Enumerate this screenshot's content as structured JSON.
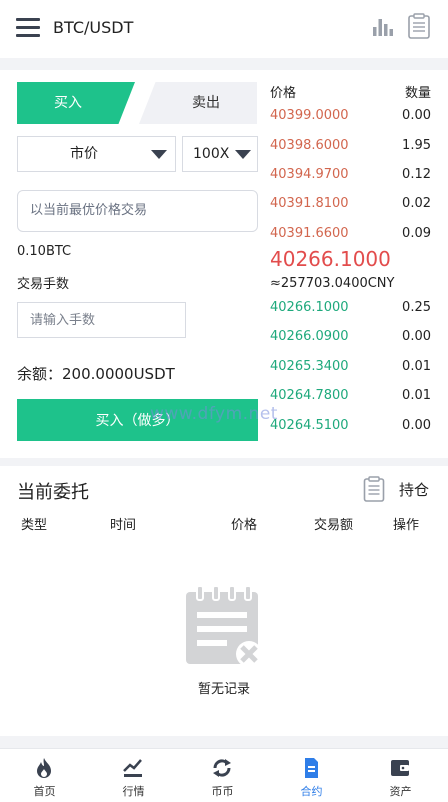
{
  "header": {
    "pair": "BTC/USDT",
    "menu_icon": "hamburger-menu-icon",
    "chart_icon": "bar-chart-icon",
    "orders_icon": "clipboard-icon"
  },
  "trade": {
    "tab_buy": "买入",
    "tab_sell": "卖出",
    "order_type": "市价",
    "leverage": "100X",
    "best_price_text": "以当前最优价格交易",
    "amount_text": "0.10BTC",
    "hands_label": "交易手数",
    "hands_placeholder": "请输入手数",
    "balance": "余额：200.0000USDT",
    "buy_button": "买入（做多）"
  },
  "orderbook": {
    "price_header": "价格",
    "qty_header": "数量",
    "asks": [
      {
        "price": "40399.0000",
        "qty": "0.00"
      },
      {
        "price": "40398.6000",
        "qty": "1.95"
      },
      {
        "price": "40394.9700",
        "qty": "0.12"
      },
      {
        "price": "40391.8100",
        "qty": "0.02"
      },
      {
        "price": "40391.6600",
        "qty": "0.09"
      }
    ],
    "last_price": "40266.1000",
    "cny_price": "≈257703.0400CNY",
    "bids": [
      {
        "price": "40266.1000",
        "qty": "0.25"
      },
      {
        "price": "40266.0900",
        "qty": "0.00"
      },
      {
        "price": "40265.3400",
        "qty": "0.01"
      },
      {
        "price": "40264.7800",
        "qty": "0.01"
      },
      {
        "price": "40264.5100",
        "qty": "0.00"
      }
    ]
  },
  "watermark": "www.dfym.net",
  "orders": {
    "title": "当前委托",
    "position_label": "持仓",
    "columns": [
      "类型",
      "时间",
      "价格",
      "交易额",
      "操作"
    ],
    "empty_text": "暂无记录"
  },
  "nav": {
    "items": [
      {
        "label": "首页",
        "icon": "flame-icon"
      },
      {
        "label": "行情",
        "icon": "market-trend-icon"
      },
      {
        "label": "币币",
        "icon": "exchange-arrows-icon"
      },
      {
        "label": "合约",
        "icon": "contract-document-icon"
      },
      {
        "label": "资产",
        "icon": "wallet-icon"
      }
    ],
    "active_index": 3
  },
  "colors": {
    "accent_green": "#1ec28b",
    "ask_red": "#d2664e",
    "bid_green": "#1ea97c",
    "last_price_red": "#e24c4c",
    "nav_active_blue": "#2f7ee8"
  }
}
